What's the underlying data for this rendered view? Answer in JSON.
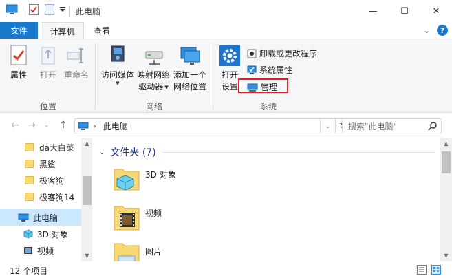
{
  "window": {
    "title": "此电脑",
    "minimize_glyph": "—",
    "maximize_glyph": "☐",
    "close_glyph": "✕"
  },
  "tabs": [
    {
      "label": "文件"
    },
    {
      "label": "计算机"
    },
    {
      "label": "查看"
    }
  ],
  "ribbon": {
    "location_group": {
      "label": "位置",
      "properties": "属性",
      "open": "打开",
      "rename": "重命名"
    },
    "network_group": {
      "label": "网络",
      "access_media": "访问媒体",
      "map_drive_line1": "映射网络",
      "map_drive_line2": "驱动器",
      "add_location_line1": "添加一个",
      "add_location_line2": "网络位置"
    },
    "system_group": {
      "label": "系统",
      "open_settings_line1": "打开",
      "open_settings_line2": "设置",
      "uninstall": "卸载或更改程序",
      "system_properties": "系统属性",
      "manage": "管理"
    }
  },
  "address": {
    "path": "此电脑",
    "search_placeholder": "搜索\"此电脑\""
  },
  "nav_pane": {
    "items": [
      {
        "label": "da大白菜"
      },
      {
        "label": "黑鲨"
      },
      {
        "label": "极客狗"
      },
      {
        "label": "极客狗14"
      },
      {
        "label": "此电脑"
      },
      {
        "label": "3D 对象"
      },
      {
        "label": "视频"
      }
    ]
  },
  "content": {
    "section_title": "文件夹 (7)",
    "folders": [
      {
        "name": "3D 对象"
      },
      {
        "name": "视频"
      },
      {
        "name": "图片"
      }
    ]
  },
  "status": {
    "item_count": "12 个项目"
  }
}
